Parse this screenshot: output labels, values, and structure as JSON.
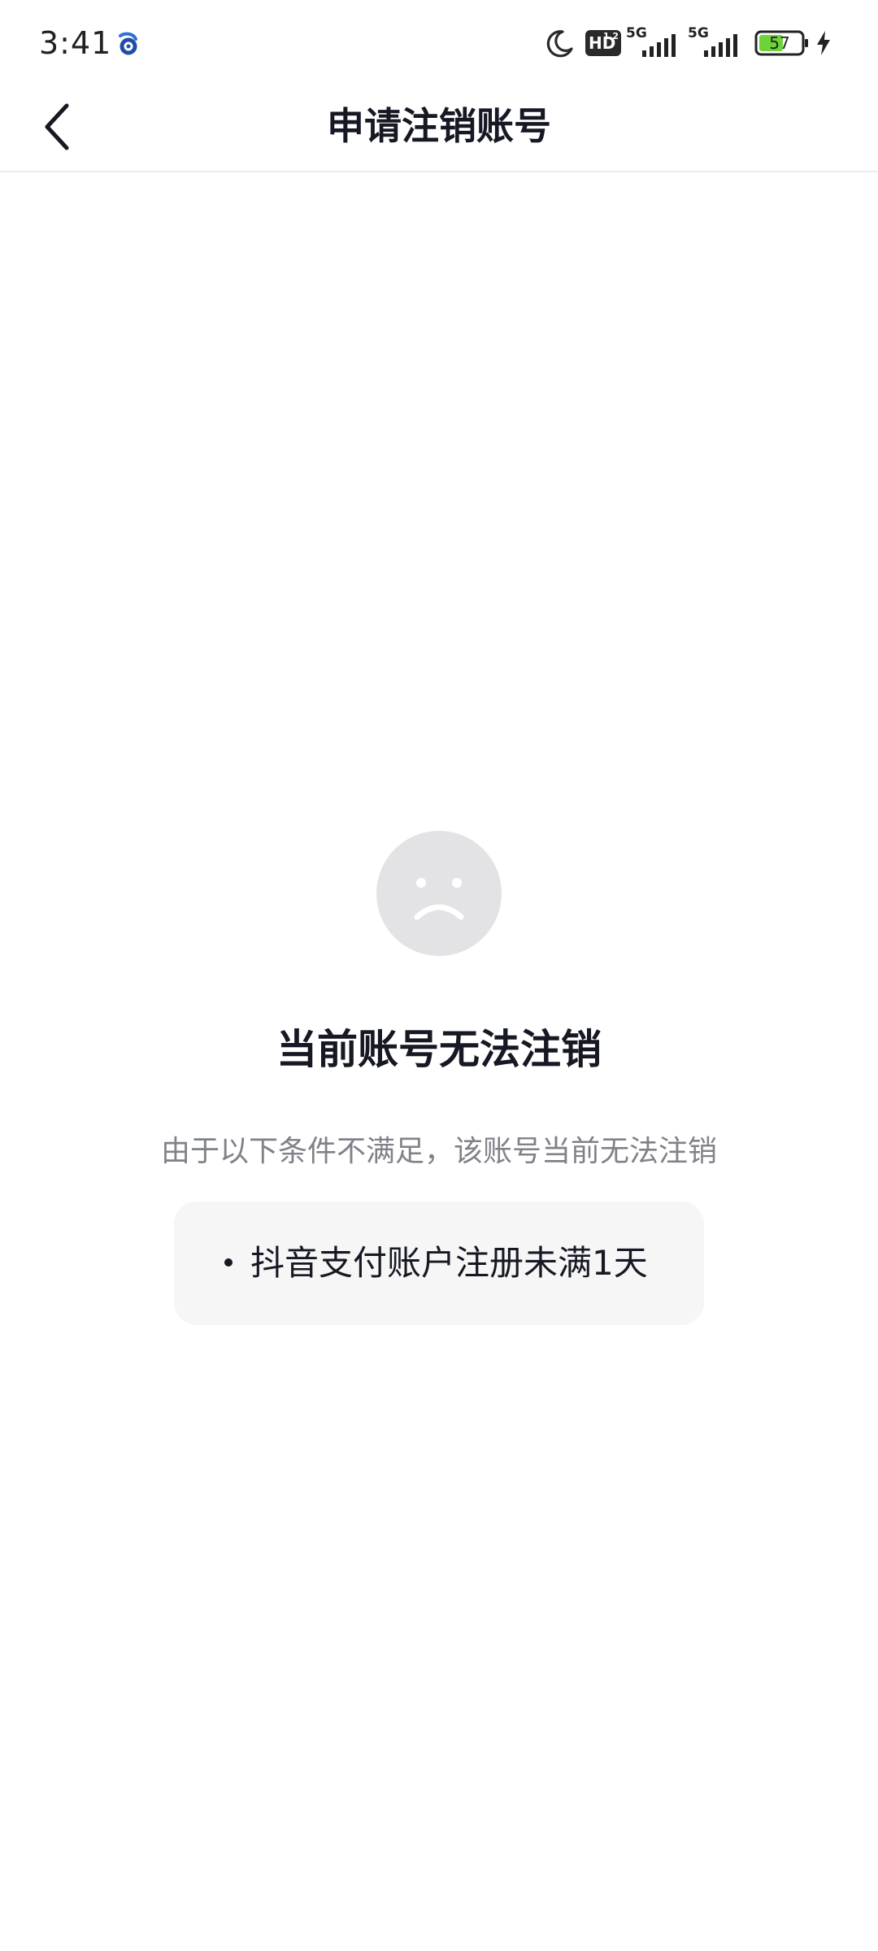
{
  "status_bar": {
    "time": "3:41",
    "hd_label": "HD",
    "hd_sub": "1 2",
    "signal_1_label": "5G",
    "signal_2_label": "5G",
    "battery_level": "57",
    "icons": [
      "app-notification-icon",
      "moon-icon",
      "signal-icon",
      "battery-icon",
      "charging-icon"
    ]
  },
  "nav": {
    "title": "申请注销账号",
    "back_icon": "chevron-left-icon"
  },
  "main": {
    "status_icon": "sad-face-icon",
    "headline": "当前账号无法注销",
    "reason": "由于以下条件不满足，该账号当前无法注销",
    "conditions": [
      "抖音支付账户注册未满1天"
    ]
  },
  "colors": {
    "background": "#ffffff",
    "primary_text": "#161823",
    "secondary_text": "#80828a",
    "card_background": "#f6f6f6",
    "icon_circle": "#e3e3e5",
    "battery_green": "#6ed33b"
  }
}
